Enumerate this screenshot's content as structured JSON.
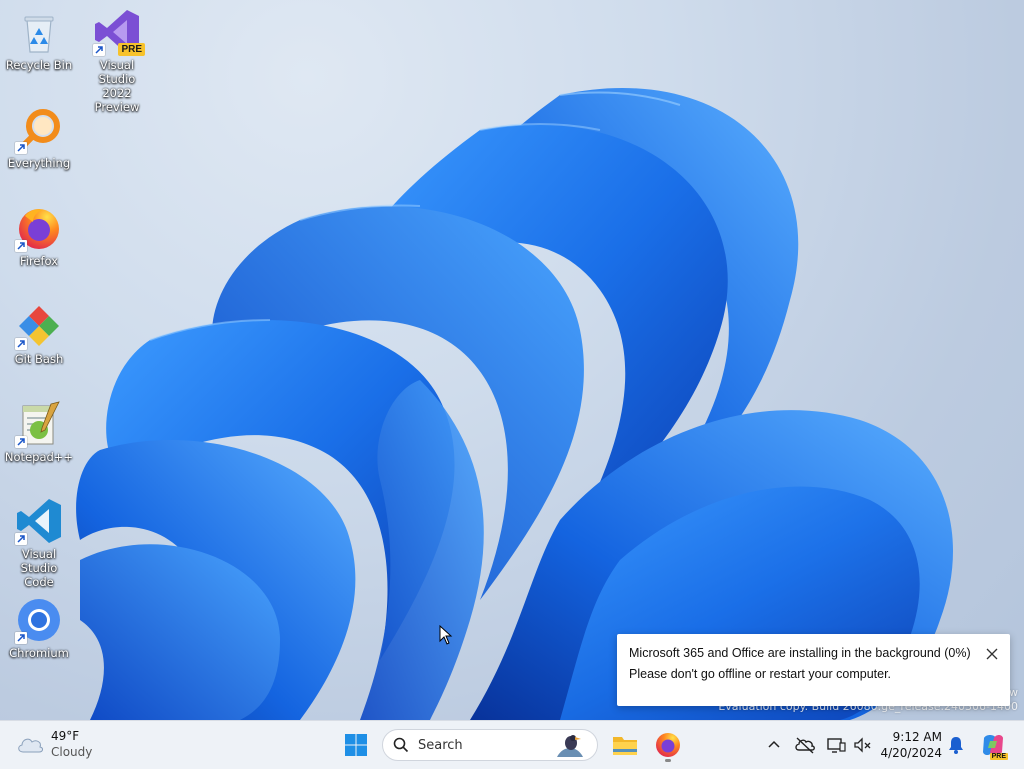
{
  "desktop": {
    "icons": [
      {
        "label_line1": "Recycle Bin",
        "label_line2": "",
        "icon": "recycle-bin-icon"
      },
      {
        "label_line1": "Visual Studio",
        "label_line2": "2022 Preview",
        "icon": "visual-studio-icon",
        "badge": "PRE"
      },
      {
        "label_line1": "Everything",
        "label_line2": "",
        "icon": "everything-search-icon"
      },
      {
        "label_line1": "Firefox",
        "label_line2": "",
        "icon": "firefox-icon"
      },
      {
        "label_line1": "Git Bash",
        "label_line2": "",
        "icon": "git-bash-icon"
      },
      {
        "label_line1": "Notepad++",
        "label_line2": "",
        "icon": "notepad-plus-plus-icon"
      },
      {
        "label_line1": "Visual Studio",
        "label_line2": "Code",
        "icon": "vscode-icon"
      },
      {
        "label_line1": "Chromium",
        "label_line2": "",
        "icon": "chromium-icon"
      }
    ],
    "watermark_line1": "w",
    "watermark_line2": "Evaluation copy. Build 26080.ge_release.240306-1400"
  },
  "notification": {
    "line1": "Microsoft 365 and Office are installing in the background (0%)",
    "line2": "Please don't go offline or restart your computer.",
    "progress": 0
  },
  "taskbar": {
    "weather": {
      "temp": "49°F",
      "desc": "Cloudy",
      "icon": "cloud-icon"
    },
    "search": {
      "placeholder": "Search"
    },
    "clock": {
      "time": "9:12 AM",
      "date": "4/20/2024"
    },
    "copilot_badge": "PRE"
  },
  "colors": {
    "wallpaper_blue": "#1a6fe8",
    "wallpaper_dark": "#0b3db0",
    "taskbar_bg": "#eef2f7",
    "accent": "#0067c0"
  }
}
